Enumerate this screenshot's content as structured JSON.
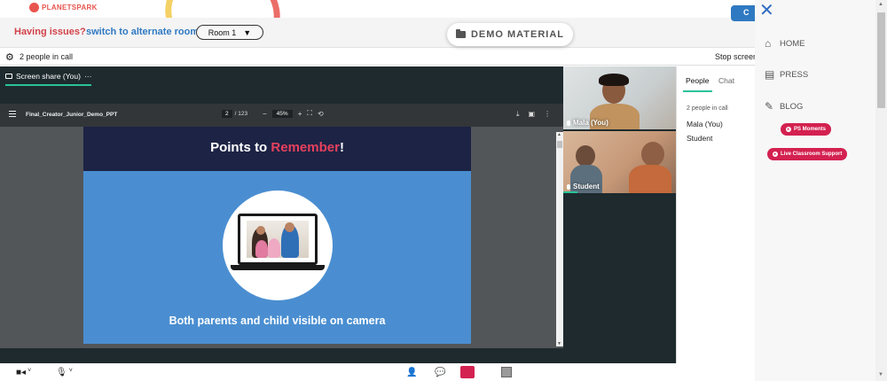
{
  "brand": {
    "logo_text": "PLANETSPARK"
  },
  "issue_bar": {
    "label": "Having issues?",
    "link": "switch to alternate room",
    "room_selected": "Room 1",
    "room_caret": "▼"
  },
  "demo_button": {
    "label": "DEMO MATERIAL"
  },
  "chat_bubble": {
    "label": "C"
  },
  "call_bar": {
    "people_count": "2 people in call",
    "stop_label": "Stop screen"
  },
  "stage": {
    "tab_label": "Screen share (You)",
    "tab_more": "···",
    "pdf": {
      "title": "Final_Creator_Junior_Demo_PPT",
      "current_page": "2",
      "total_pages": "/ 123",
      "zoom": "45%",
      "zoom_out": "−",
      "zoom_in": "+"
    },
    "slide": {
      "title_prefix": "Points to ",
      "title_accent": "Remember",
      "title_suffix": "!",
      "caption": "Both parents and child visible on camera"
    }
  },
  "videos": [
    {
      "name": "Mala (You)"
    },
    {
      "name": "Student"
    }
  ],
  "panel": {
    "tab_people": "People",
    "tab_chat": "Chat",
    "count": "2 people in call",
    "people": [
      "Mala (You)",
      "Student"
    ]
  },
  "drawer": {
    "nav": [
      {
        "label": "HOME",
        "icon": "home-icon"
      },
      {
        "label": "PRESS",
        "icon": "press-icon"
      },
      {
        "label": "BLOG",
        "icon": "pencil-icon"
      }
    ],
    "pills": [
      {
        "label": "PS Moments"
      },
      {
        "label": "Live Classroom Support"
      }
    ]
  },
  "colors": {
    "accent_green": "#2bc29a",
    "brand_red": "#d32150",
    "link_blue": "#2f79c2",
    "slide_navy": "#1c2345",
    "slide_blue": "#4a8ed1"
  }
}
